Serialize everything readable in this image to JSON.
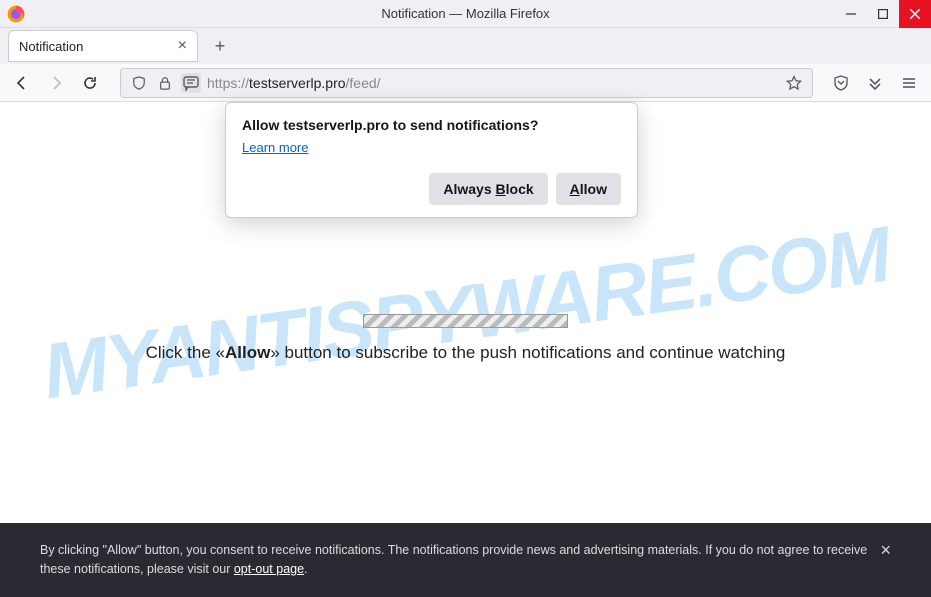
{
  "window": {
    "title": "Notification — Mozilla Firefox"
  },
  "tab": {
    "label": "Notification"
  },
  "url": {
    "scheme": "https://",
    "domain": "testserverlp.pro",
    "path": "/feed/"
  },
  "permission_prompt": {
    "title": "Allow testserverlp.pro to send notifications?",
    "learn_more": "Learn more",
    "block_prefix": "Always ",
    "block_ak": "B",
    "block_suffix": "lock",
    "allow_ak": "A",
    "allow_suffix": "llow"
  },
  "page": {
    "text_before": "Click the «",
    "text_bold": "Allow",
    "text_after": "» button to subscribe to the push notifications and continue watching"
  },
  "cookie": {
    "text_before": "By clicking \"Allow\" button, you consent to receive notifications. The notifications provide news and advertising materials. If you do not agree to receive these notifications, please visit our ",
    "optout": "opt-out page",
    "text_after": "."
  },
  "watermark": "MYANTISPYWARE.COM"
}
